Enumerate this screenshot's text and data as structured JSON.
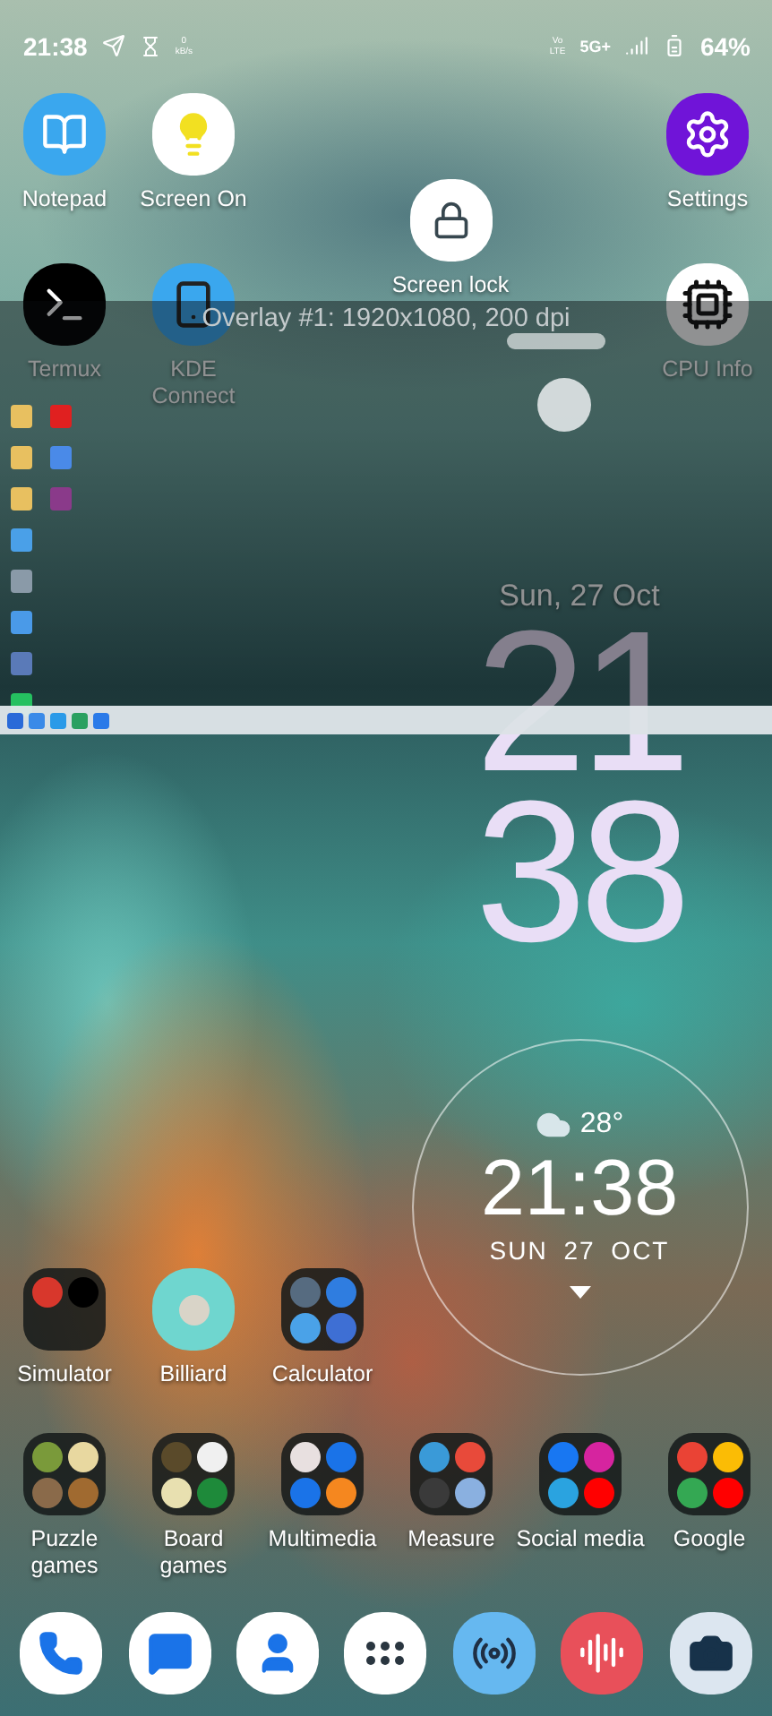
{
  "status_bar": {
    "time": "21:38",
    "net_speed": [
      "0",
      "kB/s"
    ],
    "volte": [
      "Vo",
      "LTE"
    ],
    "network": "5G+",
    "battery": "64%"
  },
  "home_apps": [
    {
      "label": "Notepad",
      "kind": "notepad"
    },
    {
      "label": "Screen On",
      "kind": "screen_on"
    },
    {
      "label": "Screen lock",
      "kind": "screen_lock"
    },
    {
      "label": "Settings",
      "kind": "settings"
    },
    {
      "label": "Termux",
      "kind": "terminal"
    },
    {
      "label": "KDE Connect",
      "kind": "kde"
    },
    {
      "label": "CPU Info",
      "kind": "cpu"
    }
  ],
  "overlay": {
    "title": "Overlay #1: 1920x1080, 200 dpi"
  },
  "clock": {
    "date": "Sun, 27 Oct",
    "hours": "21",
    "minutes": "38"
  },
  "weather_widget": {
    "temperature": "28°",
    "time": "21:38",
    "date": "SUN 27 OCT"
  },
  "middle_apps": [
    {
      "label": "Simulator",
      "kind": "folder2"
    },
    {
      "label": "Billiard",
      "kind": "billiard"
    },
    {
      "label": "Calculator",
      "kind": "folder3"
    }
  ],
  "folders": [
    {
      "label": "Puzzle games",
      "kind": "puzzle"
    },
    {
      "label": "Board games",
      "kind": "board"
    },
    {
      "label": "Multimedia",
      "kind": "multimedia"
    },
    {
      "label": "Measure",
      "kind": "measure"
    },
    {
      "label": "Social media",
      "kind": "social"
    },
    {
      "label": "Google",
      "kind": "google"
    }
  ],
  "dock": [
    {
      "kind": "phone"
    },
    {
      "kind": "messages"
    },
    {
      "kind": "contacts"
    },
    {
      "kind": "apps"
    },
    {
      "kind": "radio"
    },
    {
      "kind": "recorder"
    },
    {
      "kind": "camera"
    }
  ]
}
